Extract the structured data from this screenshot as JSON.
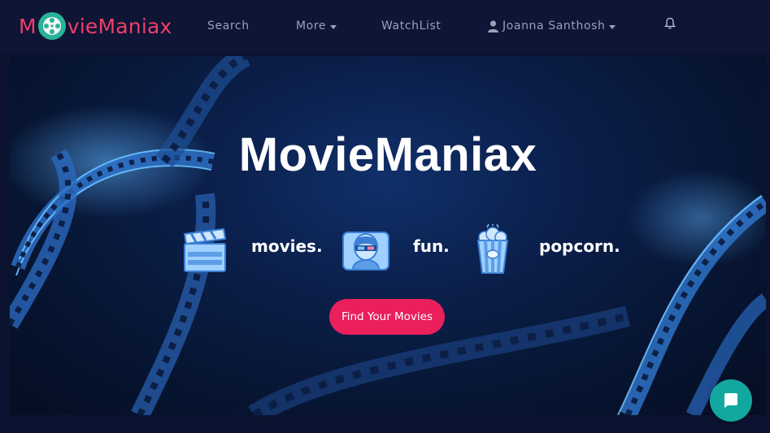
{
  "brand": {
    "name": "MovieManiax",
    "prefix": "M",
    "suffix": "vieManiax",
    "color": "#f03e6a"
  },
  "nav": {
    "search": "Search",
    "more": "More",
    "watchlist": "WatchList",
    "user": "Joanna Santhosh"
  },
  "hero": {
    "title": "MovieManiax",
    "tags": [
      "movies.",
      "fun.",
      "popcorn."
    ],
    "cta": "Find Your Movies",
    "cta_color": "#ea1f5c"
  },
  "icons": {
    "user": "user-icon",
    "bell": "bell-icon",
    "clapperboard": "clapperboard-icon",
    "moviegoer": "3d-glasses-person-icon",
    "popcorn": "popcorn-icon",
    "chat": "chat-icon"
  }
}
